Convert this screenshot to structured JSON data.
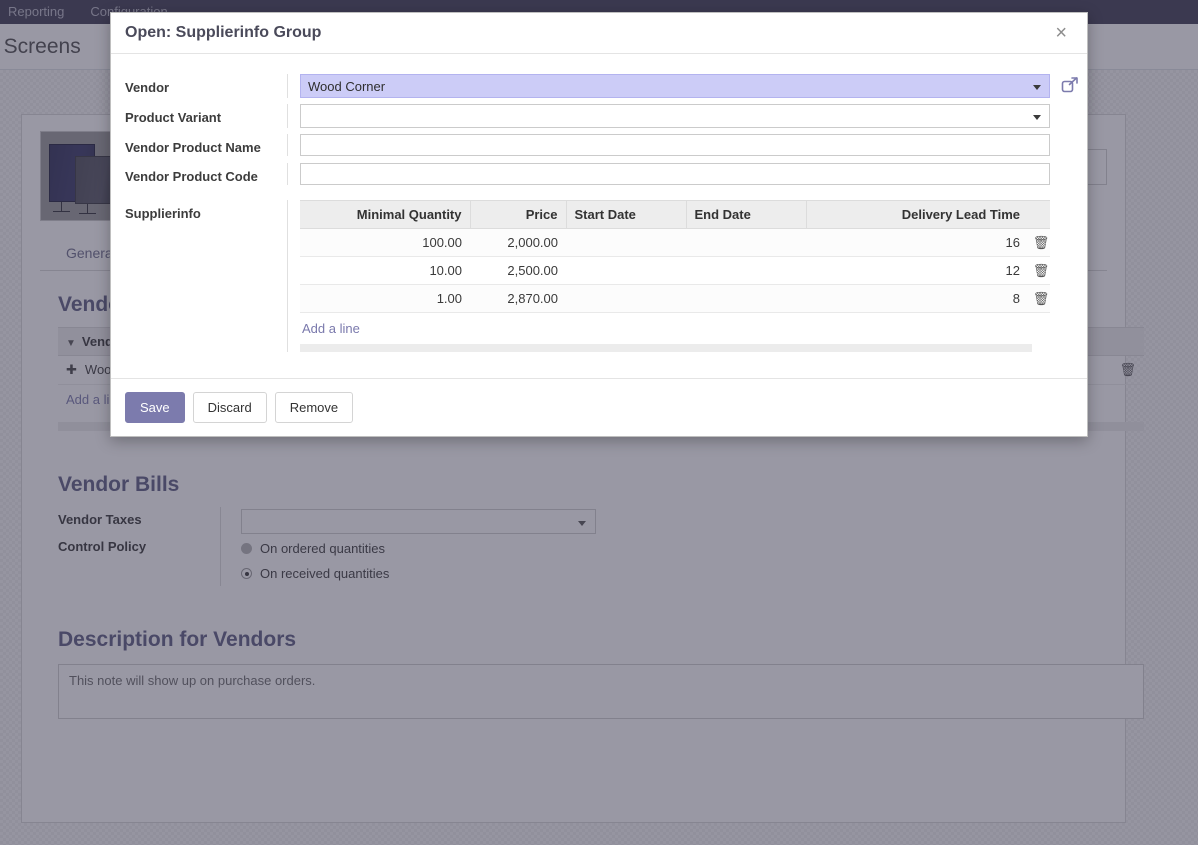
{
  "background": {
    "navbar": {
      "items": [
        {
          "label": "Reporting"
        },
        {
          "label": "Configuration"
        }
      ]
    },
    "breadcrumb": "/ Screens",
    "tabs": [
      {
        "label": "General In"
      }
    ],
    "vendors_section": {
      "title": "Vendors",
      "column_header": "Vendor",
      "rows": [
        {
          "vendor": "Wood C"
        }
      ],
      "add_line": "Add a li"
    },
    "vendor_bills_section": {
      "title": "Vendor Bills",
      "vendor_taxes_label": "Vendor Taxes",
      "vendor_taxes_value": "",
      "control_policy_label": "Control Policy",
      "control_policy_options": [
        {
          "label": "On ordered quantities",
          "selected": false
        },
        {
          "label": "On received quantities",
          "selected": true
        }
      ]
    },
    "description_section": {
      "title": "Description for Vendors",
      "text": "This note will show up on purchase orders."
    }
  },
  "modal": {
    "title": "Open: Supplierinfo Group",
    "close_label": "×",
    "fields": [
      {
        "label": "Vendor",
        "value": "Wood Corner",
        "type": "select",
        "highlighted": true,
        "has_external_link": true
      },
      {
        "label": "Product Variant",
        "value": "",
        "type": "select",
        "highlighted": false,
        "has_external_link": false
      },
      {
        "label": "Vendor Product Name",
        "value": "",
        "type": "text",
        "highlighted": false,
        "has_external_link": false
      },
      {
        "label": "Vendor Product Code",
        "value": "",
        "type": "text",
        "highlighted": false,
        "has_external_link": false
      }
    ],
    "supplierinfo": {
      "label": "Supplierinfo",
      "columns": [
        "Minimal Quantity",
        "Price",
        "Start Date",
        "End Date",
        "Delivery Lead Time"
      ],
      "rows": [
        {
          "minimal_quantity": "100.00",
          "price": "2,000.00",
          "start_date": "",
          "end_date": "",
          "delivery_lead_time": "16"
        },
        {
          "minimal_quantity": "10.00",
          "price": "2,500.00",
          "start_date": "",
          "end_date": "",
          "delivery_lead_time": "12"
        },
        {
          "minimal_quantity": "1.00",
          "price": "2,870.00",
          "start_date": "",
          "end_date": "",
          "delivery_lead_time": "8"
        }
      ],
      "add_line": "Add a line"
    },
    "buttons": {
      "save": "Save",
      "discard": "Discard",
      "remove": "Remove"
    }
  },
  "colors": {
    "brand_purple": "#7C7BAD",
    "navbar_dark": "#3C3A50",
    "highlight_field": "#CCCCF7",
    "link": "#7A79AC"
  }
}
